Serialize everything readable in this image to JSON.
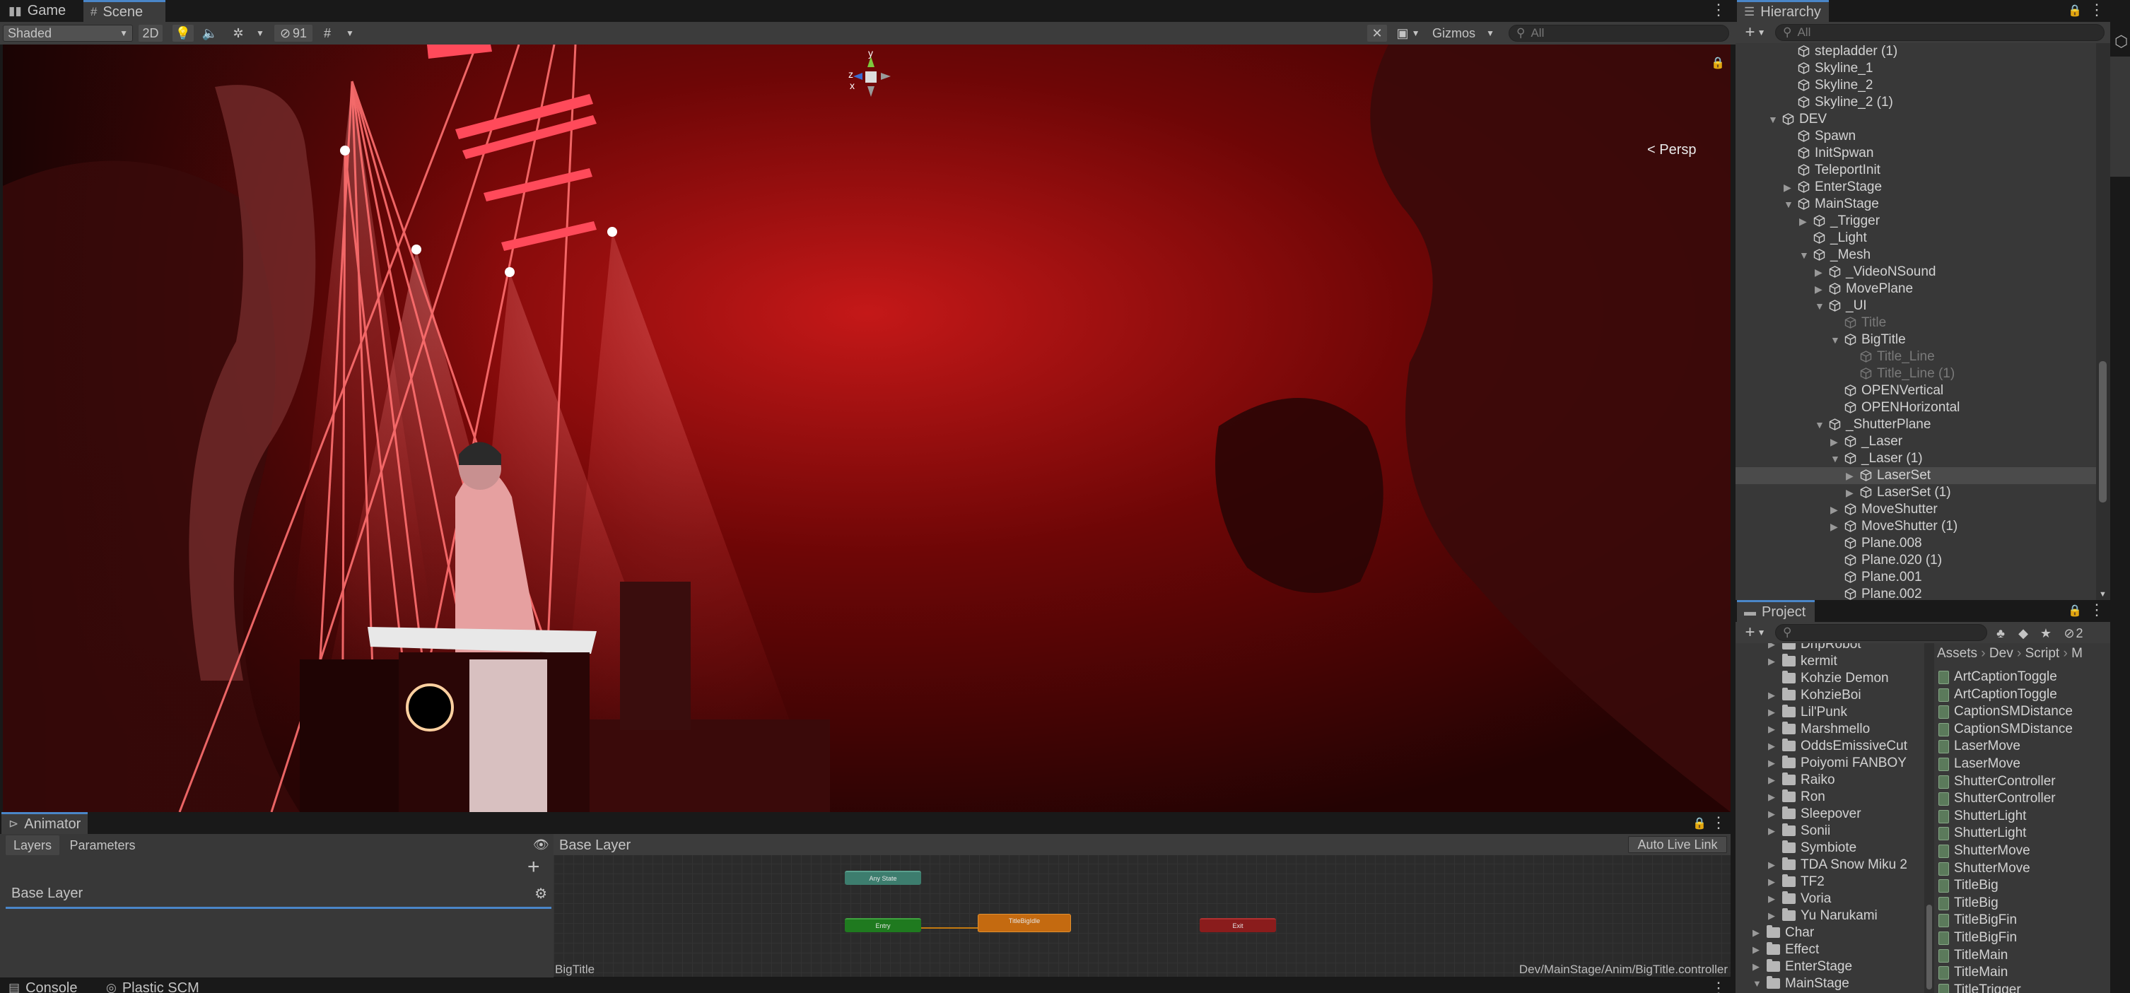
{
  "scene_tabs": {
    "game": "Game",
    "scene": "Scene"
  },
  "scene_toolbar": {
    "shading": "Shaded",
    "mode_2d": "2D",
    "hidden_count": "91",
    "gizmos": "Gizmos",
    "search_placeholder": "All"
  },
  "viewport": {
    "persp_label": "< Persp",
    "gizmo_axes": {
      "x": "x",
      "y": "y",
      "z": "z"
    }
  },
  "hierarchy": {
    "title": "Hierarchy",
    "search_placeholder": "All",
    "rows": [
      {
        "label": "stepladder (1)",
        "depth": 3,
        "arrow": "",
        "dim": false,
        "sel": false
      },
      {
        "label": "Skyline_1",
        "depth": 3,
        "arrow": "",
        "dim": false,
        "sel": false
      },
      {
        "label": "Skyline_2",
        "depth": 3,
        "arrow": "",
        "dim": false,
        "sel": false
      },
      {
        "label": "Skyline_2 (1)",
        "depth": 3,
        "arrow": "",
        "dim": false,
        "sel": false
      },
      {
        "label": "DEV",
        "depth": 2,
        "arrow": "▼",
        "dim": false,
        "sel": false
      },
      {
        "label": "Spawn",
        "depth": 3,
        "arrow": "",
        "dim": false,
        "sel": false
      },
      {
        "label": "InitSpwan",
        "depth": 3,
        "arrow": "",
        "dim": false,
        "sel": false
      },
      {
        "label": "TeleportInit",
        "depth": 3,
        "arrow": "",
        "dim": false,
        "sel": false
      },
      {
        "label": "EnterStage",
        "depth": 3,
        "arrow": "▶",
        "dim": false,
        "sel": false
      },
      {
        "label": "MainStage",
        "depth": 3,
        "arrow": "▼",
        "dim": false,
        "sel": false
      },
      {
        "label": "_Trigger",
        "depth": 4,
        "arrow": "▶",
        "dim": false,
        "sel": false
      },
      {
        "label": "_Light",
        "depth": 4,
        "arrow": "",
        "dim": false,
        "sel": false
      },
      {
        "label": "_Mesh",
        "depth": 4,
        "arrow": "▼",
        "dim": false,
        "sel": false
      },
      {
        "label": "_VideoNSound",
        "depth": 5,
        "arrow": "▶",
        "dim": false,
        "sel": false
      },
      {
        "label": "MovePlane",
        "depth": 5,
        "arrow": "▶",
        "dim": false,
        "sel": false
      },
      {
        "label": "_UI",
        "depth": 5,
        "arrow": "▼",
        "dim": false,
        "sel": false
      },
      {
        "label": "Title",
        "depth": 6,
        "arrow": "",
        "dim": true,
        "sel": false
      },
      {
        "label": "BigTitle",
        "depth": 6,
        "arrow": "▼",
        "dim": false,
        "sel": false
      },
      {
        "label": "Title_Line",
        "depth": 7,
        "arrow": "",
        "dim": true,
        "sel": false
      },
      {
        "label": "Title_Line (1)",
        "depth": 7,
        "arrow": "",
        "dim": true,
        "sel": false
      },
      {
        "label": "OPENVertical",
        "depth": 6,
        "arrow": "",
        "dim": false,
        "sel": false
      },
      {
        "label": "OPENHorizontal",
        "depth": 6,
        "arrow": "",
        "dim": false,
        "sel": false
      },
      {
        "label": "_ShutterPlane",
        "depth": 5,
        "arrow": "▼",
        "dim": false,
        "sel": false
      },
      {
        "label": "_Laser",
        "depth": 6,
        "arrow": "▶",
        "dim": false,
        "sel": false
      },
      {
        "label": "_Laser (1)",
        "depth": 6,
        "arrow": "▼",
        "dim": false,
        "sel": false
      },
      {
        "label": "LaserSet",
        "depth": 7,
        "arrow": "▶",
        "dim": false,
        "sel": true
      },
      {
        "label": "LaserSet (1)",
        "depth": 7,
        "arrow": "▶",
        "dim": false,
        "sel": false
      },
      {
        "label": "MoveShutter",
        "depth": 6,
        "arrow": "▶",
        "dim": false,
        "sel": false
      },
      {
        "label": "MoveShutter (1)",
        "depth": 6,
        "arrow": "▶",
        "dim": false,
        "sel": false
      },
      {
        "label": "Plane.008",
        "depth": 6,
        "arrow": "",
        "dim": false,
        "sel": false
      },
      {
        "label": "Plane.020 (1)",
        "depth": 6,
        "arrow": "",
        "dim": false,
        "sel": false
      },
      {
        "label": "Plane.001",
        "depth": 6,
        "arrow": "",
        "dim": false,
        "sel": false
      },
      {
        "label": "Plane.002",
        "depth": 6,
        "arrow": "",
        "dim": false,
        "sel": false
      }
    ]
  },
  "project": {
    "title": "Project",
    "hidden_count": "2",
    "breadcrumb": [
      "Assets",
      "Dev",
      "Script",
      "M"
    ],
    "folders": [
      {
        "label": "DripRobot",
        "depth": 2,
        "arrow": "▶"
      },
      {
        "label": "kermit",
        "depth": 2,
        "arrow": "▶"
      },
      {
        "label": "Kohzie Demon",
        "depth": 2,
        "arrow": ""
      },
      {
        "label": "KohzieBoi",
        "depth": 2,
        "arrow": "▶"
      },
      {
        "label": "Lil'Punk",
        "depth": 2,
        "arrow": "▶"
      },
      {
        "label": "Marshmello",
        "depth": 2,
        "arrow": "▶"
      },
      {
        "label": "OddsEmissiveCut",
        "depth": 2,
        "arrow": "▶"
      },
      {
        "label": "Poiyomi FANBOY",
        "depth": 2,
        "arrow": "▶"
      },
      {
        "label": "Raiko",
        "depth": 2,
        "arrow": "▶"
      },
      {
        "label": "Ron",
        "depth": 2,
        "arrow": "▶"
      },
      {
        "label": "Sleepover",
        "depth": 2,
        "arrow": "▶"
      },
      {
        "label": "Sonii",
        "depth": 2,
        "arrow": "▶"
      },
      {
        "label": "Symbiote",
        "depth": 2,
        "arrow": ""
      },
      {
        "label": "TDA Snow Miku 2",
        "depth": 2,
        "arrow": "▶"
      },
      {
        "label": "TF2",
        "depth": 2,
        "arrow": "▶"
      },
      {
        "label": "Voria",
        "depth": 2,
        "arrow": "▶"
      },
      {
        "label": "Yu Narukami",
        "depth": 2,
        "arrow": "▶"
      },
      {
        "label": "Char",
        "depth": 1,
        "arrow": "▶"
      },
      {
        "label": "Effect",
        "depth": 1,
        "arrow": "▶"
      },
      {
        "label": "EnterStage",
        "depth": 1,
        "arrow": "▶"
      },
      {
        "label": "MainStage",
        "depth": 1,
        "arrow": "▼"
      }
    ],
    "files": [
      "ArtCaptionToggle",
      "ArtCaptionToggle",
      "CaptionSMDistance",
      "CaptionSMDistance",
      "LaserMove",
      "LaserMove",
      "ShutterController",
      "ShutterController",
      "ShutterLight",
      "ShutterLight",
      "ShutterMove",
      "ShutterMove",
      "TitleBig",
      "TitleBig",
      "TitleBigFin",
      "TitleBigFin",
      "TitleMain",
      "TitleMain",
      "TitleTrigger"
    ]
  },
  "animator": {
    "tab": "Animator",
    "layers_tab": "Layers",
    "parameters_tab": "Parameters",
    "layer_name": "Base Layer",
    "breadcrumb": "Base Layer",
    "auto_live_link": "Auto Live Link",
    "selected_state": "BigTitle",
    "controller_path": "Dev/MainStage/Anim/BigTitle.controller",
    "nodes": {
      "any_state": "Any State",
      "entry": "Entry",
      "default_state": "TitleBigIdle",
      "exit": "Exit"
    }
  },
  "bottom_tabs": {
    "console": "Console",
    "plastic": "Plastic SCM"
  },
  "colors": {
    "accent": "#4a86c8",
    "node_any": "#3d7d6e",
    "node_entry": "#1f7a1f",
    "node_default": "#c46a10",
    "node_exit": "#8a1c1c",
    "selection": "#4b4b4b"
  }
}
